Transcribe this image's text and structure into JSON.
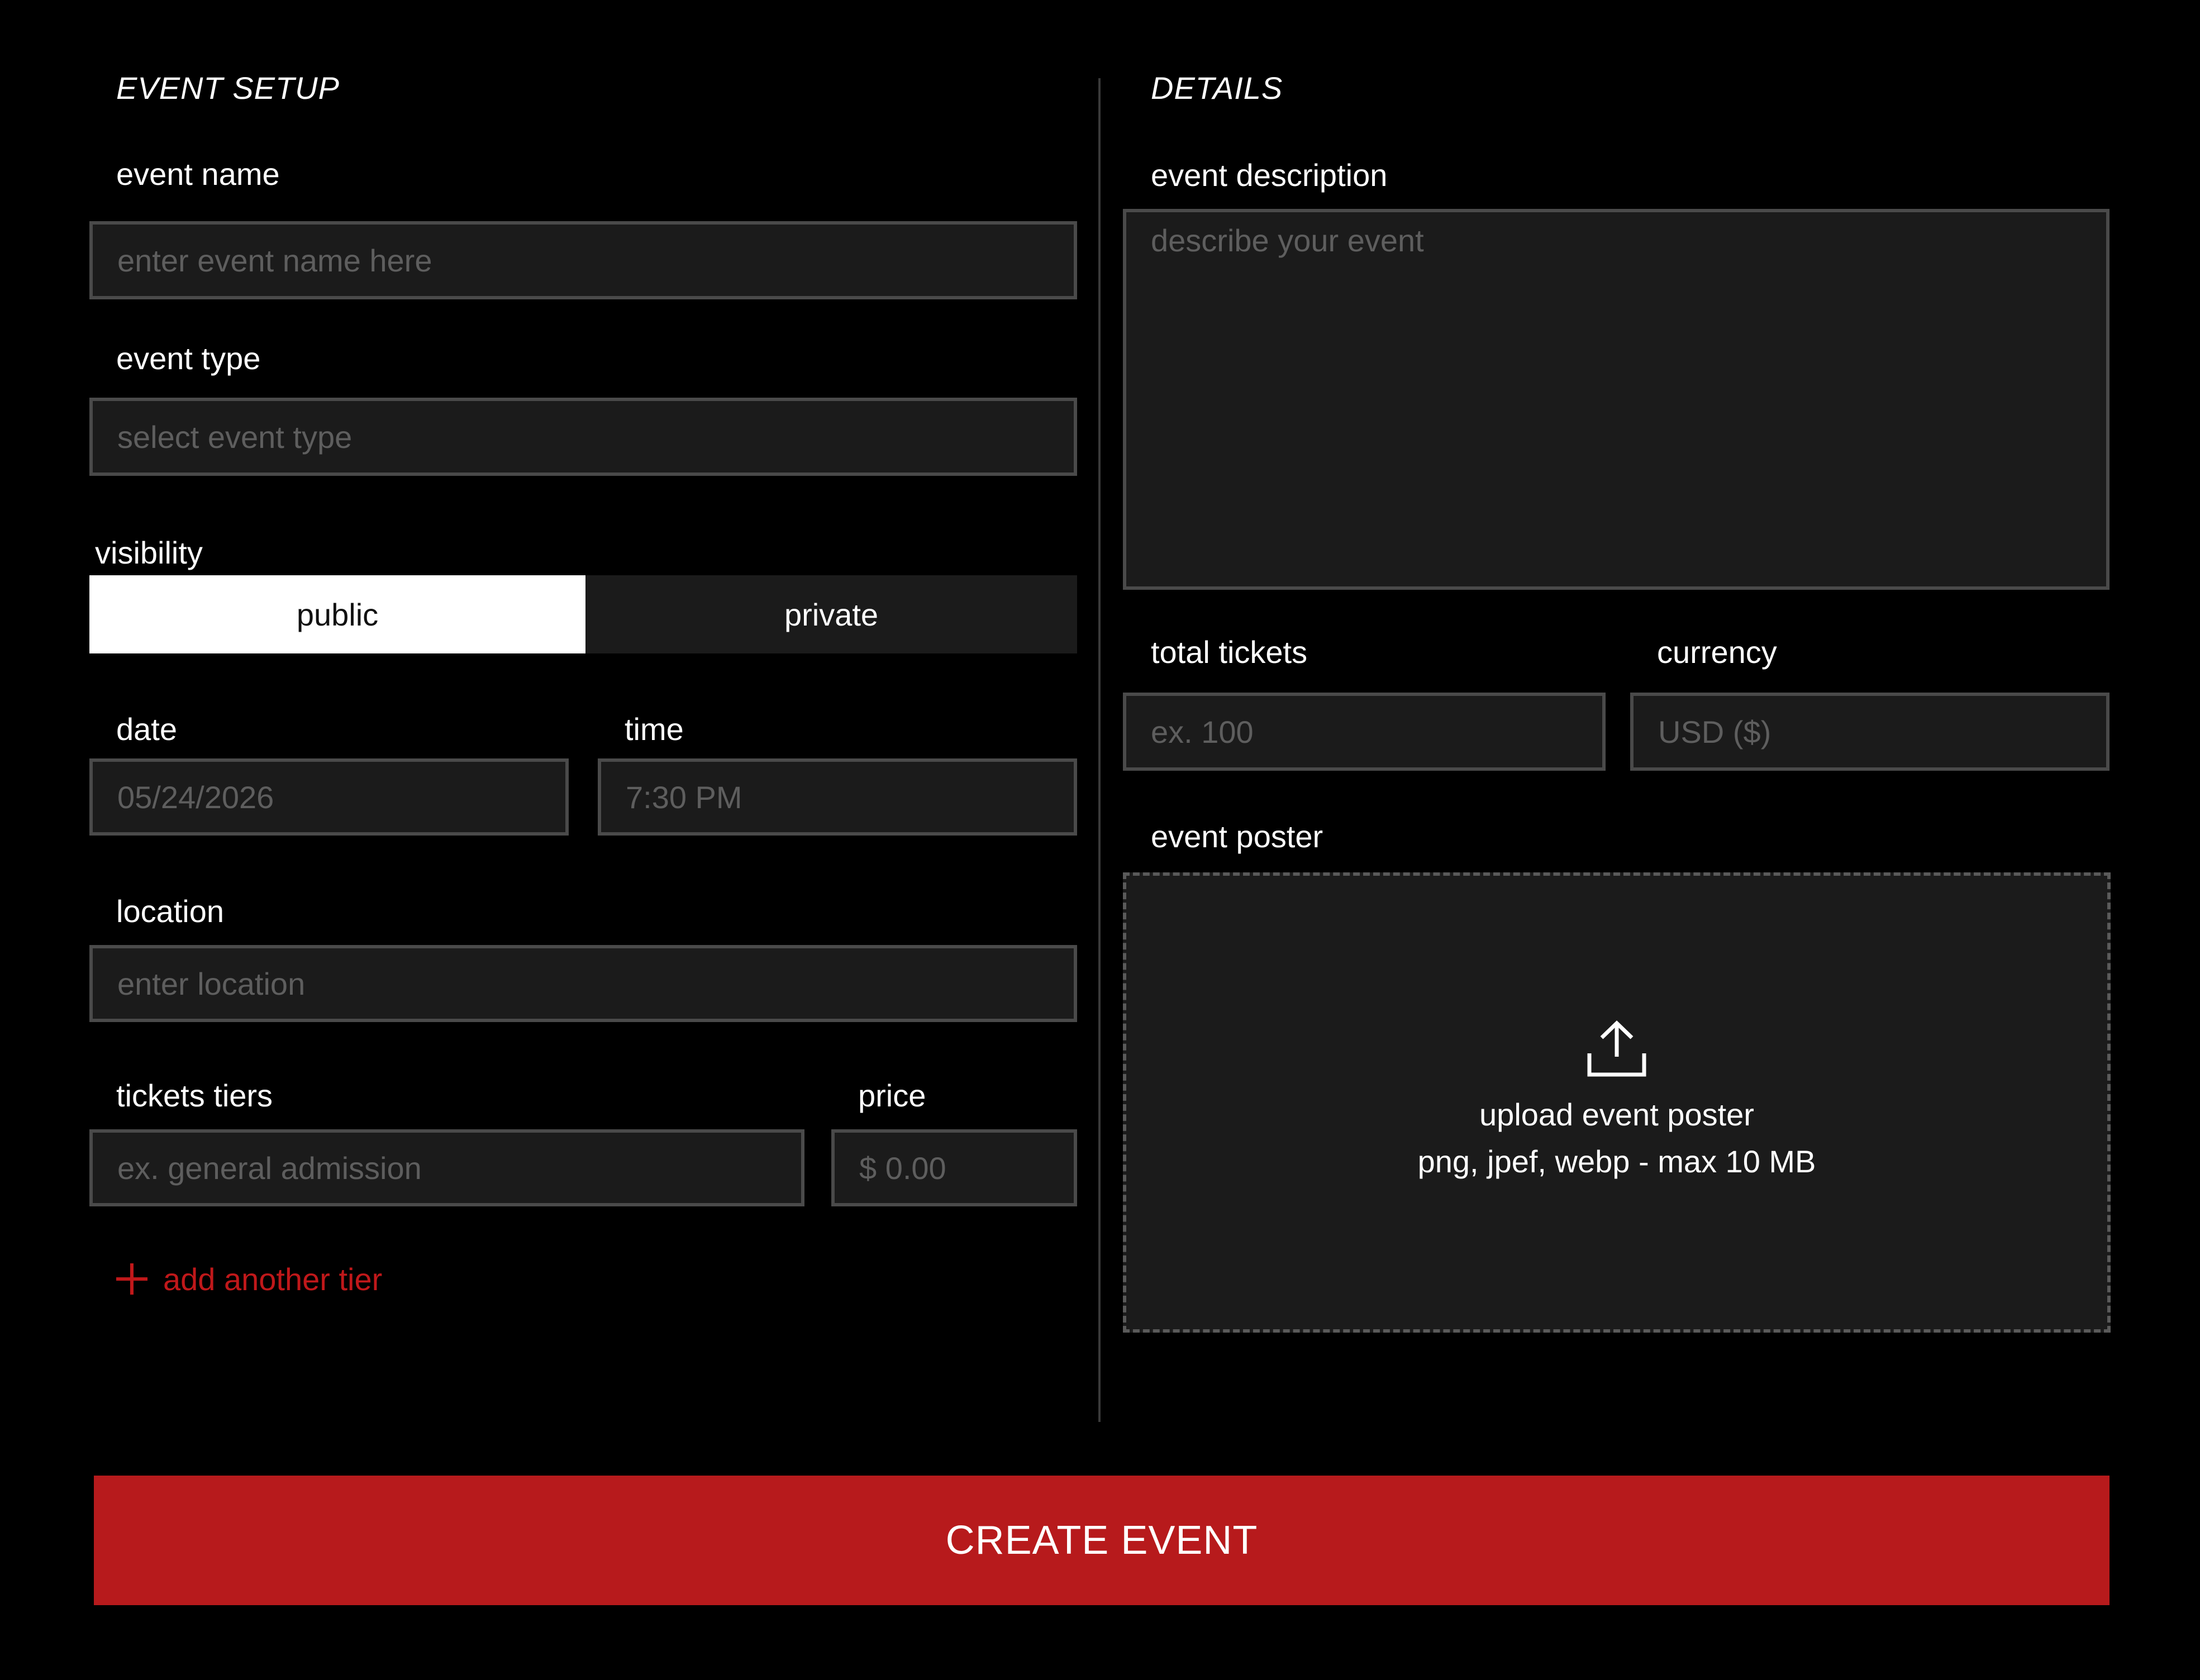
{
  "left": {
    "section_title": "EVENT SETUP",
    "event_name": {
      "label": "event name",
      "placeholder": "enter event name here"
    },
    "event_type": {
      "label": "event type",
      "placeholder": "select event type"
    },
    "visibility": {
      "label": "visibility",
      "options": [
        "public",
        "private"
      ],
      "selected": "public"
    },
    "date": {
      "label": "date",
      "placeholder": "05/24/2026"
    },
    "time": {
      "label": "time",
      "placeholder": "7:30 PM"
    },
    "location": {
      "label": "location",
      "placeholder": "enter location"
    },
    "ticket_tiers": {
      "label": "tickets tiers",
      "placeholder": "ex. general admission"
    },
    "price": {
      "label": "price",
      "placeholder": "$ 0.00"
    },
    "add_tier_label": "add another tier"
  },
  "right": {
    "section_title": "DETAILS",
    "event_description": {
      "label": "event description",
      "placeholder": "describe your event"
    },
    "total_tickets": {
      "label": "total tickets",
      "placeholder": "ex. 100"
    },
    "currency": {
      "label": "currency",
      "placeholder": "USD ($)"
    },
    "event_poster": {
      "label": "event poster",
      "upload_title": "upload event poster",
      "upload_hint": "png, jpef, webp - max 10 MB",
      "icon": "upload-icon"
    }
  },
  "footer": {
    "create_label": "CREATE EVENT"
  },
  "colors": {
    "background": "#000000",
    "field": "#1b1b1b",
    "border": "#4a4a4a",
    "accent": "#b71a1c"
  }
}
